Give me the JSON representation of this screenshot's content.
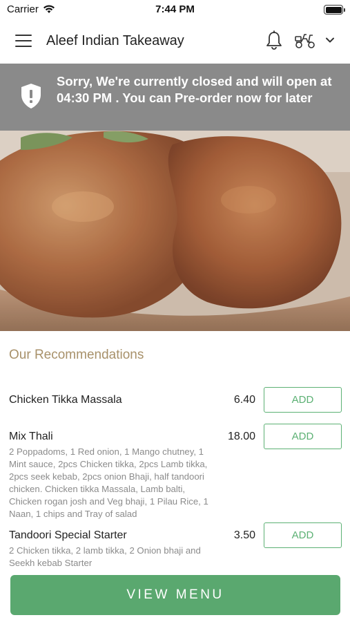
{
  "status_bar": {
    "carrier": "Carrier",
    "time": "7:44 PM"
  },
  "header": {
    "title": "Aleef Indian Takeaway"
  },
  "banner": {
    "message": "Sorry, We're currently closed and will open at 04:30 PM . You can Pre-order now for later"
  },
  "recommendations": {
    "title": "Our Recommendations",
    "items": [
      {
        "name": "Chicken Tikka Massala",
        "price": "6.40",
        "description": "",
        "button": "ADD"
      },
      {
        "name": "Mix Thali",
        "price": "18.00",
        "description": "2 Poppadoms, 1 Red onion, 1 Mango chutney, 1 Mint sauce, 2pcs Chicken tikka, 2pcs Lamb tikka, 2pcs seek kebab, 2pcs onion Bhaji, half tandoori chicken. Chicken tikka Massala, Lamb balti, Chicken rogan josh and Veg bhaji, 1 Pilau Rice, 1 Naan, 1 chips and Tray of salad",
        "button": "ADD"
      },
      {
        "name": "Tandoori Special Starter",
        "price": "3.50",
        "description": "2 Chicken tikka, 2 lamb tikka, 2 Onion bhaji and Seekh kebab Starter",
        "button": "ADD"
      }
    ]
  },
  "footer": {
    "view_menu_label": "VIEW MENU"
  },
  "colors": {
    "accent_green": "#5aa86f",
    "banner_gray": "#8a8a8a",
    "section_title": "#a8916a"
  },
  "icons": [
    "wifi-icon",
    "battery-icon",
    "menu-icon",
    "bell-icon",
    "scooter-icon",
    "chevron-down-icon",
    "shield-alert-icon"
  ]
}
